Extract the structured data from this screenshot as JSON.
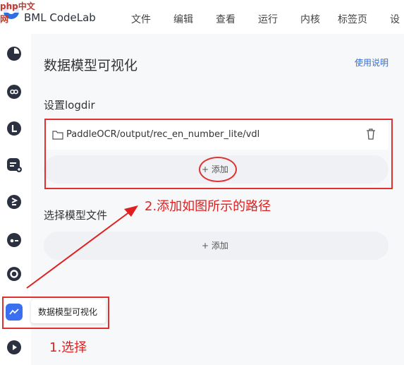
{
  "watermark": {
    "badge": "php中文网"
  },
  "header": {
    "app_title": "BML CodeLab",
    "menu": [
      "文件",
      "编辑",
      "查看",
      "运行",
      "内核",
      "标签页",
      "设"
    ]
  },
  "sidebar": {
    "icons": [
      "notebook-icon",
      "infinity-icon",
      "l-icon",
      "list-add-icon",
      "greater-equal-icon",
      "toggle-icon",
      "circle-icon",
      "chart-icon",
      "play-icon"
    ],
    "active_tooltip": "数据模型可视化"
  },
  "main": {
    "title": "数据模型可视化",
    "help_link": "使用说明",
    "logdir_section": {
      "label": "设置logdir",
      "path": "PaddleOCR/output/rec_en_number_lite/vdl",
      "add_label": "添加"
    },
    "model_section": {
      "label": "选择模型文件",
      "add_label": "添加"
    }
  },
  "annotations": {
    "step1": "1.选择",
    "step2": "2.添加如图所示的路径",
    "color": "#e02020"
  }
}
